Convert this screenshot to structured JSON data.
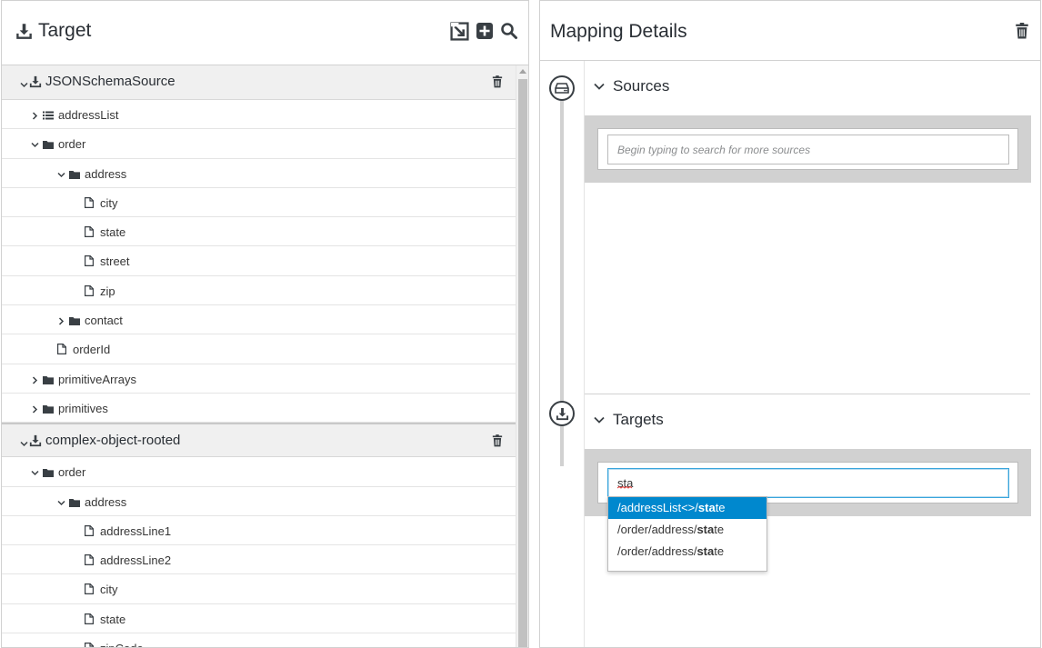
{
  "left_panel": {
    "title": "Target",
    "tools": [
      "import-icon",
      "add-icon",
      "search-icon"
    ],
    "documents": [
      {
        "name": "JSONSchemaSource",
        "rows": [
          {
            "label": "addressList",
            "kind": "collection",
            "level": 1,
            "expandable": true,
            "expanded": false
          },
          {
            "label": "order",
            "kind": "folder",
            "level": 1,
            "expandable": true,
            "expanded": true
          },
          {
            "label": "address",
            "kind": "folder",
            "level": 2,
            "expandable": true,
            "expanded": true
          },
          {
            "label": "city",
            "kind": "file",
            "level": 3,
            "expandable": false
          },
          {
            "label": "state",
            "kind": "file",
            "level": 3,
            "expandable": false
          },
          {
            "label": "street",
            "kind": "file",
            "level": 3,
            "expandable": false
          },
          {
            "label": "zip",
            "kind": "file",
            "level": 3,
            "expandable": false
          },
          {
            "label": "contact",
            "kind": "folder",
            "level": 2,
            "expandable": true,
            "expanded": false
          },
          {
            "label": "orderId",
            "kind": "file",
            "level": 2,
            "expandable": false
          },
          {
            "label": "primitiveArrays",
            "kind": "folder",
            "level": 1,
            "expandable": true,
            "expanded": false
          },
          {
            "label": "primitives",
            "kind": "folder",
            "level": 1,
            "expandable": true,
            "expanded": false
          }
        ]
      },
      {
        "name": "complex-object-rooted",
        "rows": [
          {
            "label": "order",
            "kind": "folder",
            "level": 1,
            "expandable": true,
            "expanded": true
          },
          {
            "label": "address",
            "kind": "folder",
            "level": 2,
            "expandable": true,
            "expanded": true
          },
          {
            "label": "addressLine1",
            "kind": "file",
            "level": 3,
            "expandable": false
          },
          {
            "label": "addressLine2",
            "kind": "file",
            "level": 3,
            "expandable": false
          },
          {
            "label": "city",
            "kind": "file",
            "level": 3,
            "expandable": false
          },
          {
            "label": "state",
            "kind": "file",
            "level": 3,
            "expandable": false
          },
          {
            "label": "zipCode",
            "kind": "file",
            "level": 3,
            "expandable": false
          }
        ]
      }
    ]
  },
  "right_panel": {
    "title": "Mapping Details",
    "sources": {
      "label": "Sources",
      "placeholder": "Begin typing to search for more sources",
      "value": ""
    },
    "targets": {
      "label": "Targets",
      "value": "sta"
    },
    "suggestions": [
      {
        "prefix": "/addressList<>/",
        "match": "sta",
        "suffix": "te",
        "active": true
      },
      {
        "prefix": "/order/address/",
        "match": "sta",
        "suffix": "te",
        "active": false
      },
      {
        "prefix": "/order/address/",
        "match": "sta",
        "suffix": "te",
        "active": false
      }
    ]
  }
}
